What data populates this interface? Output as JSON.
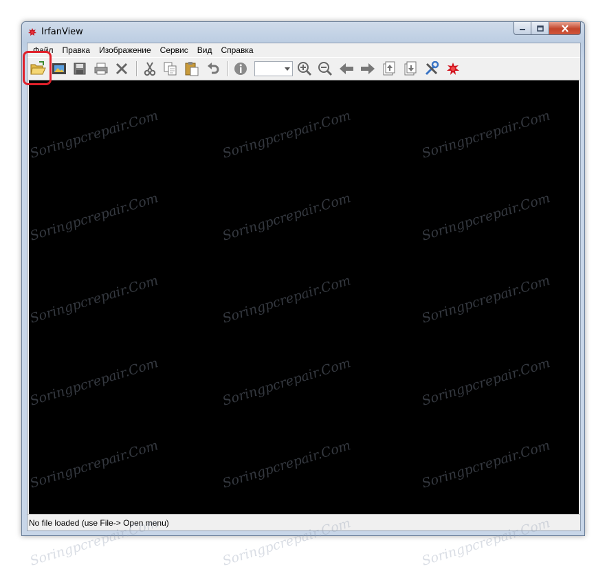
{
  "window": {
    "title": "IrfanView",
    "caption_buttons": [
      "minimize-icon",
      "maximize-icon",
      "close-icon"
    ]
  },
  "menu": [
    {
      "label": "Файл"
    },
    {
      "label": "Правка"
    },
    {
      "label": "Изображение"
    },
    {
      "label": "Сервис"
    },
    {
      "label": "Вид"
    },
    {
      "label": "Справка"
    }
  ],
  "toolbar": {
    "buttons": [
      "open-folder-icon",
      "slideshow-icon",
      "save-icon",
      "print-icon",
      "delete-icon",
      "cut-icon",
      "copy-icon",
      "paste-icon",
      "undo-icon",
      "info-icon",
      "zoom-in-icon",
      "zoom-out-icon",
      "previous-arrow-icon",
      "next-arrow-icon",
      "first-file-icon",
      "last-file-icon",
      "options-tools-icon",
      "irfanview-logo-icon"
    ],
    "zoom_value": "",
    "highlighted_button": "open-folder-icon",
    "highlight_color": "#e0202a"
  },
  "status": {
    "text": "No file loaded (use File-> Open menu)"
  },
  "watermark": {
    "text": "Soringpcrepair.Com"
  },
  "colors": {
    "canvas_background": "#000000",
    "frame": "#bccde2",
    "close_button": "#c2452b"
  }
}
